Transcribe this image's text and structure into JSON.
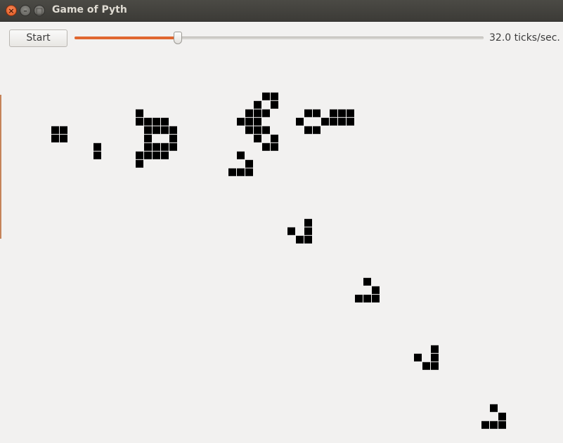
{
  "window": {
    "title": "Game of Pyth",
    "controls": {
      "close_icon": "×",
      "minimize_icon": "–",
      "maximize_icon": "□"
    }
  },
  "toolbar": {
    "start_label": "Start",
    "speed_value": 32.0,
    "speed_fraction": 0.253,
    "speed_label": "32.0 ticks/sec.",
    "accent_color": "#e0662f"
  },
  "board": {
    "cell_color": "#000000",
    "live_cells": [
      [
        6,
        15
      ],
      [
        7,
        15
      ],
      [
        6,
        16
      ],
      [
        7,
        16
      ],
      [
        11,
        17
      ],
      [
        11,
        18
      ],
      [
        16,
        13
      ],
      [
        16,
        14
      ],
      [
        17,
        14
      ],
      [
        18,
        14
      ],
      [
        19,
        14
      ],
      [
        17,
        15
      ],
      [
        18,
        15
      ],
      [
        19,
        15
      ],
      [
        20,
        15
      ],
      [
        17,
        16
      ],
      [
        20,
        16
      ],
      [
        17,
        17
      ],
      [
        18,
        17
      ],
      [
        19,
        17
      ],
      [
        20,
        17
      ],
      [
        16,
        18
      ],
      [
        17,
        18
      ],
      [
        18,
        18
      ],
      [
        19,
        18
      ],
      [
        16,
        19
      ],
      [
        31,
        11
      ],
      [
        32,
        11
      ],
      [
        30,
        12
      ],
      [
        32,
        12
      ],
      [
        29,
        13
      ],
      [
        30,
        13
      ],
      [
        31,
        13
      ],
      [
        28,
        14
      ],
      [
        29,
        14
      ],
      [
        30,
        14
      ],
      [
        29,
        15
      ],
      [
        30,
        15
      ],
      [
        31,
        15
      ],
      [
        30,
        16
      ],
      [
        32,
        16
      ],
      [
        31,
        17
      ],
      [
        32,
        17
      ],
      [
        28,
        18
      ],
      [
        29,
        19
      ],
      [
        27,
        20
      ],
      [
        28,
        20
      ],
      [
        29,
        20
      ],
      [
        36,
        13
      ],
      [
        37,
        13
      ],
      [
        39,
        13
      ],
      [
        40,
        13
      ],
      [
        41,
        13
      ],
      [
        35,
        14
      ],
      [
        38,
        14
      ],
      [
        39,
        14
      ],
      [
        40,
        14
      ],
      [
        41,
        14
      ],
      [
        36,
        15
      ],
      [
        37,
        15
      ],
      [
        36,
        26
      ],
      [
        34,
        27
      ],
      [
        36,
        27
      ],
      [
        35,
        28
      ],
      [
        36,
        28
      ],
      [
        43,
        33
      ],
      [
        44,
        34
      ],
      [
        42,
        35
      ],
      [
        43,
        35
      ],
      [
        44,
        35
      ],
      [
        51,
        41
      ],
      [
        49,
        42
      ],
      [
        51,
        42
      ],
      [
        50,
        43
      ],
      [
        51,
        43
      ],
      [
        58,
        48
      ],
      [
        59,
        49
      ],
      [
        57,
        50
      ],
      [
        58,
        50
      ],
      [
        59,
        50
      ]
    ]
  }
}
